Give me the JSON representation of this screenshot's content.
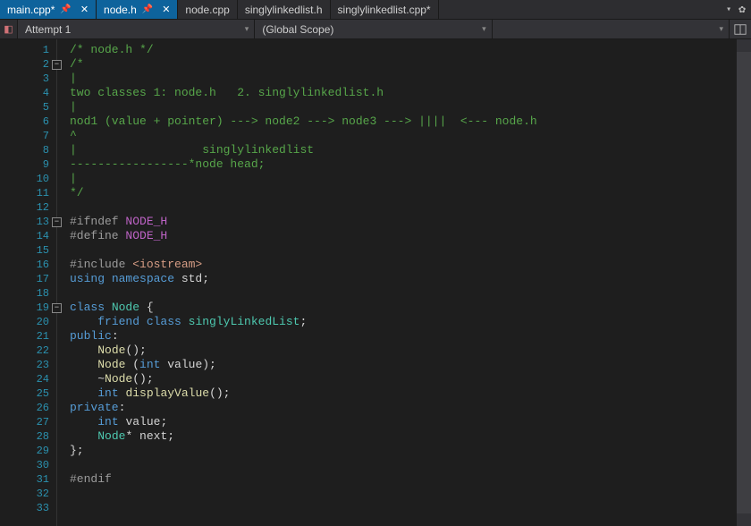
{
  "tabs": [
    {
      "label": "main.cpp*",
      "active": true,
      "pinned": true
    },
    {
      "label": "node.h",
      "active": true,
      "pinned": true
    },
    {
      "label": "node.cpp",
      "active": false,
      "pinned": false
    },
    {
      "label": "singlylinkedlist.h",
      "active": false,
      "pinned": false
    },
    {
      "label": "singlylinkedlist.cpp*",
      "active": false,
      "pinned": false
    }
  ],
  "scope": {
    "project": "Attempt 1",
    "scope_label": "(Global Scope)",
    "member": ""
  },
  "code_lines": [
    {
      "n": 1,
      "tokens": [
        [
          "c-comment",
          "/* node.h */"
        ]
      ]
    },
    {
      "n": 2,
      "fold": true,
      "tokens": [
        [
          "c-comment",
          "/*"
        ]
      ]
    },
    {
      "n": 3,
      "tokens": [
        [
          "c-comment",
          "|"
        ]
      ]
    },
    {
      "n": 4,
      "tokens": [
        [
          "c-comment",
          "two classes 1: node.h   2. singlylinkedlist.h"
        ]
      ]
    },
    {
      "n": 5,
      "tokens": [
        [
          "c-comment",
          "|"
        ]
      ]
    },
    {
      "n": 6,
      "tokens": [
        [
          "c-comment",
          "nod1 (value + pointer) ---> node2 ---> node3 ---> ||||  <--- node.h"
        ]
      ]
    },
    {
      "n": 7,
      "tokens": [
        [
          "c-comment",
          "^"
        ]
      ]
    },
    {
      "n": 8,
      "tokens": [
        [
          "c-comment",
          "|                  singlylinkedlist"
        ]
      ]
    },
    {
      "n": 9,
      "tokens": [
        [
          "c-comment",
          "-----------------*node head;"
        ]
      ]
    },
    {
      "n": 10,
      "tokens": [
        [
          "c-comment",
          "|"
        ]
      ]
    },
    {
      "n": 11,
      "tokens": [
        [
          "c-comment",
          "*/"
        ]
      ]
    },
    {
      "n": 12,
      "tokens": []
    },
    {
      "n": 13,
      "fold": true,
      "tokens": [
        [
          "c-preproc",
          "#ifndef "
        ],
        [
          "c-macro",
          "NODE_H"
        ]
      ]
    },
    {
      "n": 14,
      "tokens": [
        [
          "c-preproc",
          "#define "
        ],
        [
          "c-macro",
          "NODE_H"
        ]
      ]
    },
    {
      "n": 15,
      "tokens": []
    },
    {
      "n": 16,
      "tokens": [
        [
          "c-preproc",
          "#include "
        ],
        [
          "c-string",
          "<iostream>"
        ]
      ]
    },
    {
      "n": 17,
      "tokens": [
        [
          "c-keyword",
          "using "
        ],
        [
          "c-keyword",
          "namespace "
        ],
        [
          "c-ident",
          "std"
        ],
        [
          "c-ident",
          ";"
        ]
      ]
    },
    {
      "n": 18,
      "tokens": []
    },
    {
      "n": 19,
      "fold": true,
      "tokens": [
        [
          "c-keyword",
          "class "
        ],
        [
          "c-type",
          "Node"
        ],
        [
          "c-ident",
          " {"
        ]
      ]
    },
    {
      "n": 20,
      "tokens": [
        [
          "c-ident",
          "    "
        ],
        [
          "c-keyword",
          "friend "
        ],
        [
          "c-keyword",
          "class "
        ],
        [
          "c-type",
          "singlyLinkedList"
        ],
        [
          "c-ident",
          ";"
        ]
      ]
    },
    {
      "n": 21,
      "tokens": [
        [
          "c-keyword",
          "public"
        ],
        [
          "c-ident",
          ":"
        ]
      ]
    },
    {
      "n": 22,
      "tokens": [
        [
          "c-ident",
          "    "
        ],
        [
          "c-func",
          "Node"
        ],
        [
          "c-ident",
          "();"
        ]
      ]
    },
    {
      "n": 23,
      "tokens": [
        [
          "c-ident",
          "    "
        ],
        [
          "c-func",
          "Node"
        ],
        [
          "c-ident",
          " ("
        ],
        [
          "c-keyword",
          "int"
        ],
        [
          "c-ident",
          " value);"
        ]
      ]
    },
    {
      "n": 24,
      "tokens": [
        [
          "c-ident",
          "    ~"
        ],
        [
          "c-func",
          "Node"
        ],
        [
          "c-ident",
          "();"
        ]
      ]
    },
    {
      "n": 25,
      "tokens": [
        [
          "c-ident",
          "    "
        ],
        [
          "c-keyword",
          "int "
        ],
        [
          "c-func",
          "displayValue"
        ],
        [
          "c-ident",
          "();"
        ]
      ]
    },
    {
      "n": 26,
      "tokens": [
        [
          "c-keyword",
          "private"
        ],
        [
          "c-ident",
          ":"
        ]
      ]
    },
    {
      "n": 27,
      "tokens": [
        [
          "c-ident",
          "    "
        ],
        [
          "c-keyword",
          "int "
        ],
        [
          "c-ident",
          "value;"
        ]
      ]
    },
    {
      "n": 28,
      "tokens": [
        [
          "c-ident",
          "    "
        ],
        [
          "c-type",
          "Node"
        ],
        [
          "c-ident",
          "* next;"
        ]
      ]
    },
    {
      "n": 29,
      "tokens": [
        [
          "c-ident",
          "};"
        ]
      ]
    },
    {
      "n": 30,
      "tokens": []
    },
    {
      "n": 31,
      "tokens": [
        [
          "c-preproc",
          "#endif"
        ]
      ]
    },
    {
      "n": 32,
      "tokens": []
    },
    {
      "n": 33,
      "tokens": []
    }
  ]
}
